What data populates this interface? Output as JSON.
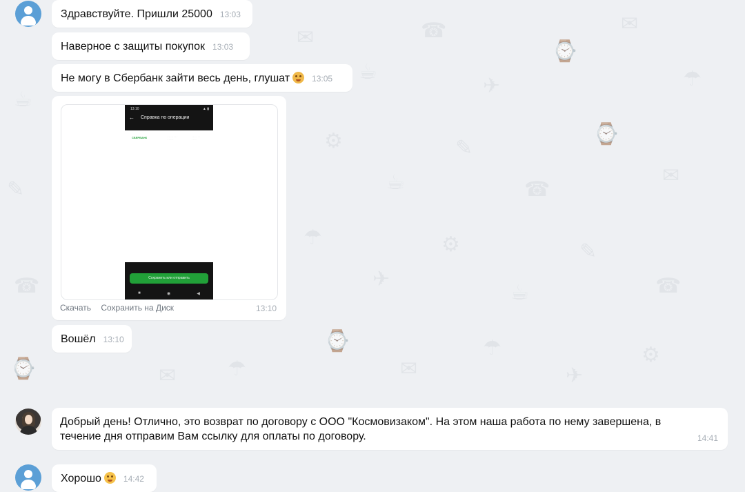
{
  "colors": {
    "background": "#eef0f3",
    "bubble": "#ffffff",
    "timestamp": "#a6adb5",
    "avatar_user": "#5b9fd6",
    "sber_green": "#21a038"
  },
  "avatars": {
    "customer_icon": "user-avatar-icon",
    "agent_icon": "profile-photo"
  },
  "messages": [
    {
      "text": "Здравствуйте. Пришли 25000",
      "time": "13:03"
    },
    {
      "text": "Наверное с защиты покупок",
      "time": "13:03"
    },
    {
      "text": "Не могу в Сбербанк зайти весь день, глушат",
      "emoji": "dizzy-face",
      "time": "13:05"
    }
  ],
  "photo_message": {
    "screenshot": {
      "status_time": "13:10",
      "header_title": "Справка по операции",
      "bank_logo": "СБЕРБАНК",
      "button_label": "Сохранить или отправить"
    },
    "actions": [
      "Скачать",
      "Сохранить на Диск"
    ],
    "time": "13:10"
  },
  "message_after_photo": {
    "text": "Вошёл",
    "time": "13:10"
  },
  "reply": {
    "text": "Добрый день! Отлично, это возврат по договору с ООО \"Космовизаком\". На этом наша работа по нему завершена, в течение дня отправим Вам ссылку для оплаты по договору.",
    "time": "14:41"
  },
  "last_message": {
    "text": "Хорошо",
    "emoji": "hugging-face",
    "time": "14:42"
  }
}
